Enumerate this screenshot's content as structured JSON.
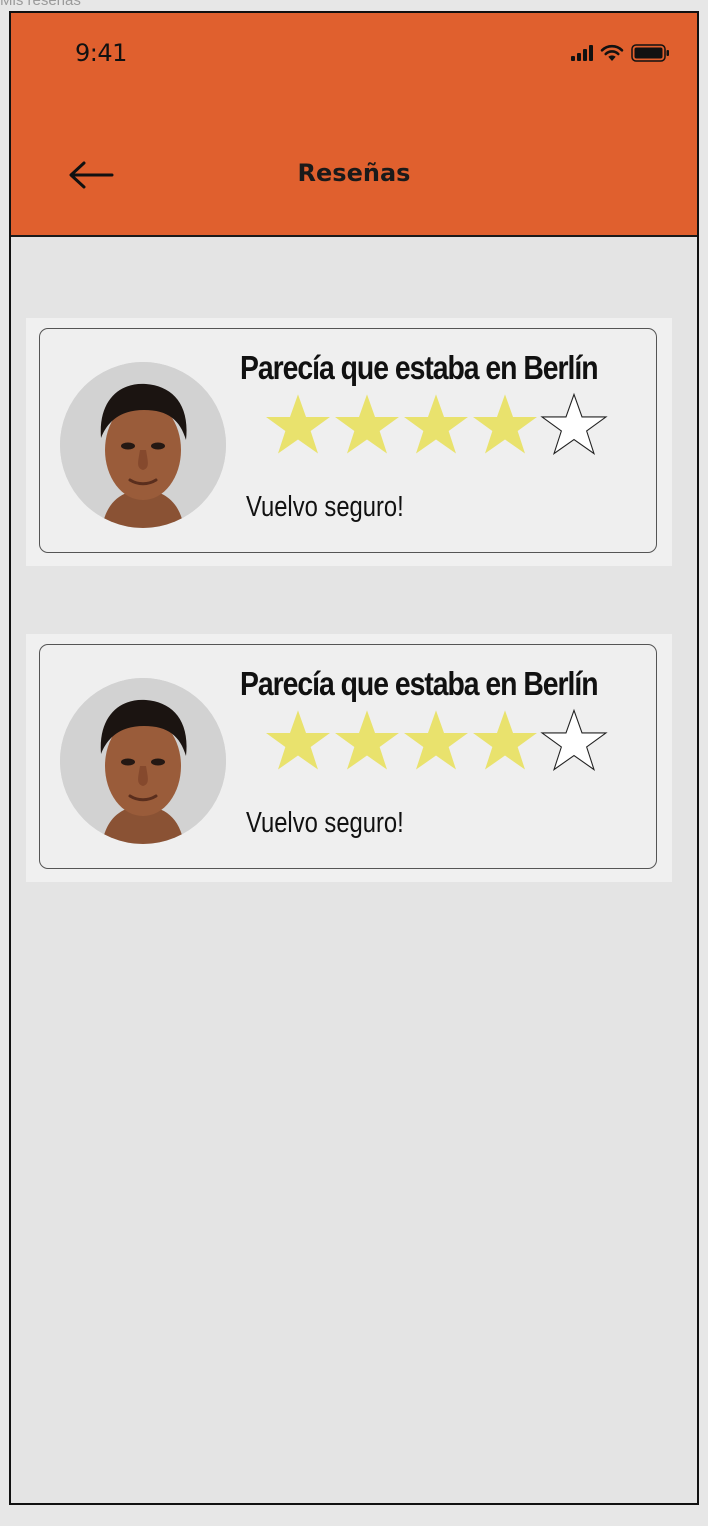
{
  "frame_label": "Mis reseñas",
  "status_bar": {
    "time": "9:41",
    "icons": [
      "signal-icon",
      "wifi-icon",
      "battery-icon"
    ]
  },
  "header": {
    "title": "Reseñas",
    "back_icon": "arrow-left-icon"
  },
  "colors": {
    "header_bg": "#e0602e",
    "page_bg": "#e4e4e4",
    "card_bg": "#efefef",
    "star_filled": "#e9e26d",
    "star_empty": "#ffffff"
  },
  "reviews": [
    {
      "title": "Parecía que estaba en Berlín",
      "rating": 4,
      "max_rating": 5,
      "text": "Vuelvo seguro!"
    },
    {
      "title": "Parecía que estaba en Berlín",
      "rating": 4,
      "max_rating": 5,
      "text": "Vuelvo seguro!"
    }
  ]
}
